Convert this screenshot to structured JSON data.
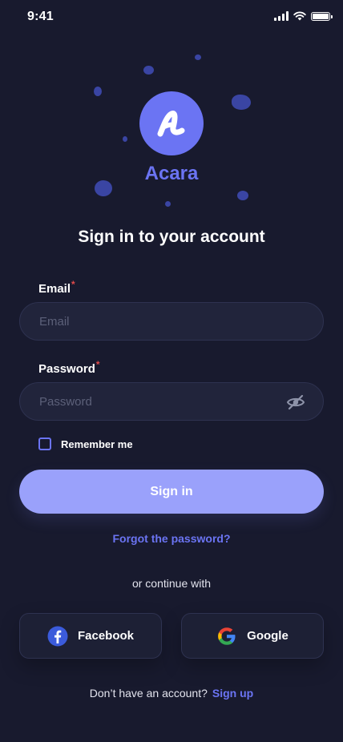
{
  "status_bar": {
    "time": "9:41"
  },
  "brand": {
    "name": "Acara",
    "logo_glyph": "a",
    "accent_color": "#6b74f3"
  },
  "title": "Sign in to your account",
  "email": {
    "label": "Email",
    "required_marker": "*",
    "placeholder": "Email",
    "value": ""
  },
  "password": {
    "label": "Password",
    "required_marker": "*",
    "placeholder": "Password",
    "value": "",
    "toggle_icon": "eye-off-icon"
  },
  "remember_me": {
    "label": "Remember me",
    "checked": false
  },
  "signin_button": {
    "label": "Sign in"
  },
  "forgot_password": {
    "label": "Forgot the password?"
  },
  "continue_with": "or continue with",
  "social": {
    "facebook": {
      "label": "Facebook",
      "icon": "facebook-icon"
    },
    "google": {
      "label": "Google",
      "icon": "google-icon"
    }
  },
  "footer": {
    "prompt": "Don’t have an account?",
    "signup_label": "Sign up"
  }
}
